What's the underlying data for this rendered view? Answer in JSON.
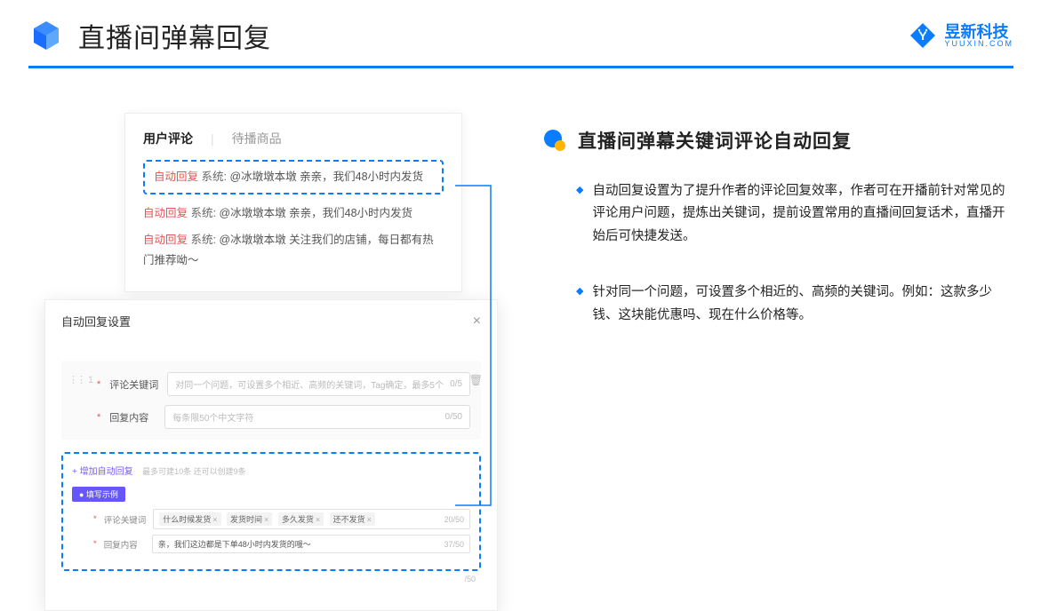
{
  "header": {
    "title": "直播间弹幕回复",
    "brand_cn": "昱新科技",
    "brand_en": "YUUXIN.COM"
  },
  "comments": {
    "tab_active": "用户评论",
    "tab_inactive": "待播商品",
    "rows": [
      {
        "tag": "自动回复",
        "sys": "系统:",
        "user": "@冰墩墩本墩",
        "text": "亲亲，我们48小时内发货"
      },
      {
        "tag": "自动回复",
        "sys": "系统:",
        "user": "@冰墩墩本墩",
        "text": "亲亲，我们48小时内发货"
      },
      {
        "tag": "自动回复",
        "sys": "系统:",
        "user": "@冰墩墩本墩",
        "text": "关注我们的店铺，每日都有热门推荐呦～"
      }
    ]
  },
  "settings": {
    "title": "自动回复设置",
    "index": "1",
    "keyword_label": "评论关键词",
    "keyword_placeholder": "对同一个问题，可设置多个相近、高频的关键词，Tag确定，最多5个",
    "keyword_count": "0/5",
    "content_label": "回复内容",
    "content_placeholder": "每条限50个中文字符",
    "content_count": "0/50",
    "add_link": "+ 增加自动回复",
    "add_hint": "最多可建10条 还可以创建9条",
    "example_badge": "● 填写示例",
    "ex_keyword_label": "评论关键词",
    "ex_tags": [
      "什么时候发货",
      "发货时间",
      "多久发货",
      "还不发货"
    ],
    "ex_keyword_count": "20/50",
    "ex_content_label": "回复内容",
    "ex_content_value": "亲，我们这边都是下单48小时内发货的哦～",
    "ex_content_count": "37/50",
    "trailing_count": "/50"
  },
  "right": {
    "section_title": "直播间弹幕关键词评论自动回复",
    "bullets": [
      "自动回复设置为了提升作者的评论回复效率，作者可在开播前针对常见的评论用户问题，提炼出关键词，提前设置常用的直播间回复话术，直播开始后可快捷发送。",
      "针对同一个问题，可设置多个相近的、高频的关键词。例如：这款多少钱、这块能优惠吗、现在什么价格等。"
    ]
  }
}
